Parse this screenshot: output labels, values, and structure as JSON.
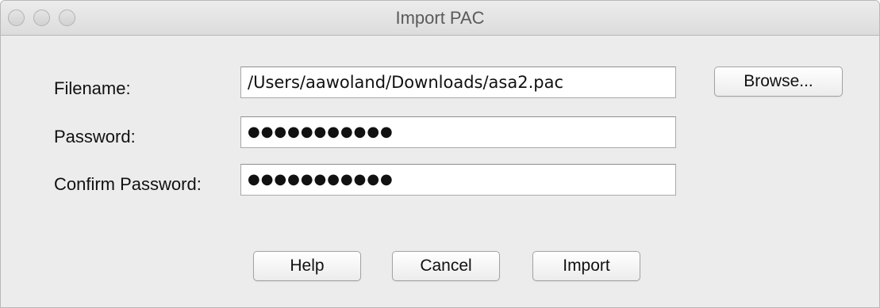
{
  "window": {
    "title": "Import PAC"
  },
  "form": {
    "filename_label": "Filename:",
    "filename_value": "/Users/aawoland/Downloads/asa2.pac",
    "password_label": "Password:",
    "password_value": "●●●●●●●●●●●",
    "confirm_label": "Confirm Password:",
    "confirm_value": "●●●●●●●●●●●"
  },
  "buttons": {
    "browse": "Browse...",
    "help": "Help",
    "cancel": "Cancel",
    "import": "Import"
  }
}
